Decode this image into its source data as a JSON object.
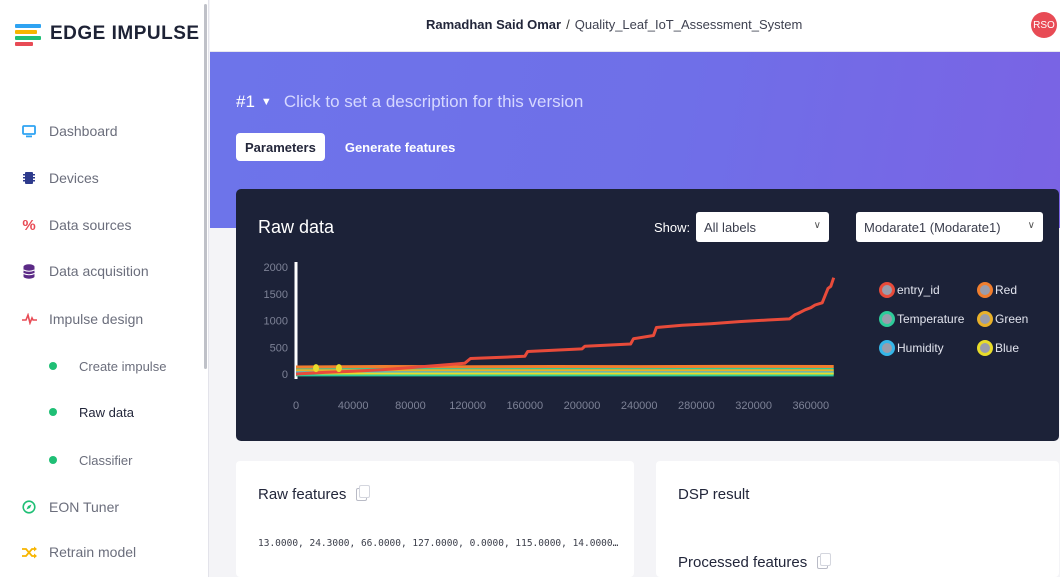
{
  "app": {
    "logo_text": "EDGE IMPULSE",
    "logo_colors": [
      "#2ea3f2",
      "#f7b500",
      "#1fbf75",
      "#e84b55"
    ]
  },
  "topbar": {
    "user": "Ramadhan Said Omar",
    "separator": "/",
    "project": "Quality_Leaf_IoT_Assessment_System",
    "avatar_initials": "RSO",
    "avatar_color": "#e84b55"
  },
  "sidebar": {
    "items": [
      {
        "label": "Dashboard",
        "icon": "monitor-icon",
        "color": "#2ea3f2"
      },
      {
        "label": "Devices",
        "icon": "chip-icon",
        "color": "#2d3a8c"
      },
      {
        "label": "Data sources",
        "icon": "percent-icon",
        "color": "#e84b55"
      },
      {
        "label": "Data acquisition",
        "icon": "database-icon",
        "color": "#5b2a86"
      },
      {
        "label": "Impulse design",
        "icon": "pulse-icon",
        "color": "#e84b55"
      },
      {
        "label": "EON Tuner",
        "icon": "compass-icon",
        "color": "#1fbf75"
      },
      {
        "label": "Retrain model",
        "icon": "shuffle-icon",
        "color": "#f7b500"
      }
    ],
    "subitems": [
      {
        "label": "Create impulse",
        "active": false
      },
      {
        "label": "Raw data",
        "active": true
      },
      {
        "label": "Classifier",
        "active": false
      }
    ]
  },
  "hero": {
    "version": "#1",
    "description": "Click to set a description for this version",
    "tabs": [
      {
        "label": "Parameters",
        "active": true
      },
      {
        "label": "Generate features",
        "active": false
      }
    ]
  },
  "raw_data": {
    "title": "Raw data",
    "show_label": "Show:",
    "label_filter": "All labels",
    "sample": "Modarate1 (Modarate1)"
  },
  "chart_data": {
    "type": "line",
    "yticks": [
      "2000",
      "1500",
      "1000",
      "500",
      "0"
    ],
    "xticks": [
      "0",
      "40000",
      "80000",
      "120000",
      "160000",
      "200000",
      "240000",
      "280000",
      "320000",
      "360000"
    ],
    "xlim": [
      0,
      400000
    ],
    "ylim": [
      0,
      2000
    ],
    "legend_position": "right",
    "series": [
      {
        "name": "entry_id",
        "color": "#e84b3a",
        "x": [
          0,
          20000,
          40000,
          60000,
          80000,
          100000,
          118000,
          122000,
          160000,
          162000,
          200000,
          202000,
          234000,
          236000,
          250000,
          252000,
          270000,
          290000,
          310000,
          330000,
          345000,
          349000,
          351000,
          356000,
          360000,
          363000,
          368000,
          372000,
          374000,
          376000
        ],
        "y": [
          0,
          30,
          50,
          80,
          120,
          160,
          200,
          290,
          330,
          420,
          470,
          520,
          560,
          660,
          720,
          870,
          910,
          940,
          980,
          1010,
          1030,
          1110,
          1130,
          1200,
          1240,
          1290,
          1330,
          1600,
          1640,
          1800
        ]
      },
      {
        "name": "Red",
        "color": "#f07e2e",
        "x": [
          0,
          60000,
          120000,
          180000,
          240000,
          300000,
          376000
        ],
        "y": [
          130,
          140,
          135,
          140,
          138,
          142,
          140
        ]
      },
      {
        "name": "Temperature",
        "color": "#2ecc9a",
        "x": [
          0,
          376000
        ],
        "y": [
          40,
          40
        ]
      },
      {
        "name": "Green",
        "color": "#e8b12a",
        "x": [
          0,
          376000
        ],
        "y": [
          60,
          60
        ]
      },
      {
        "name": "Humidity",
        "color": "#35b6e8",
        "x": [
          0,
          376000
        ],
        "y": [
          20,
          20
        ]
      },
      {
        "name": "Blue",
        "color": "#e8dc2a",
        "x": [
          0,
          376000
        ],
        "y": [
          10,
          10
        ]
      }
    ],
    "markers": [
      {
        "series": "Blue",
        "x": [
          14000,
          30000
        ],
        "y": [
          110,
          110
        ]
      }
    ]
  },
  "cards": {
    "raw_features_title": "Raw features",
    "raw_features_values": "13.0000, 24.3000, 66.0000, 127.0000, 0.0000, 115.0000, 14.0000…",
    "dsp_title": "DSP result",
    "processed_title": "Processed features"
  }
}
